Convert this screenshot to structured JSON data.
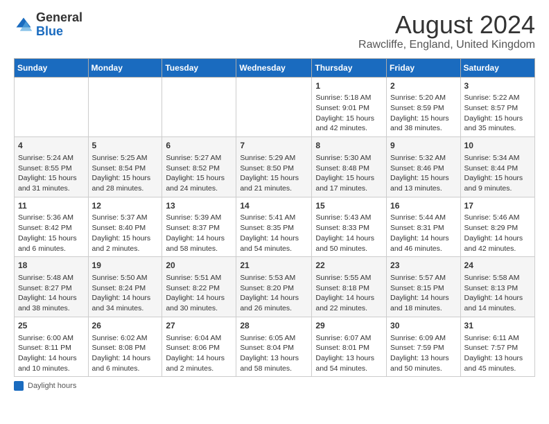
{
  "header": {
    "logo_line1": "General",
    "logo_line2": "Blue",
    "main_title": "August 2024",
    "sub_title": "Rawcliffe, England, United Kingdom"
  },
  "days_of_week": [
    "Sunday",
    "Monday",
    "Tuesday",
    "Wednesday",
    "Thursday",
    "Friday",
    "Saturday"
  ],
  "weeks": [
    [
      {
        "day": "",
        "info": ""
      },
      {
        "day": "",
        "info": ""
      },
      {
        "day": "",
        "info": ""
      },
      {
        "day": "",
        "info": ""
      },
      {
        "day": "1",
        "info": "Sunrise: 5:18 AM\nSunset: 9:01 PM\nDaylight: 15 hours and 42 minutes."
      },
      {
        "day": "2",
        "info": "Sunrise: 5:20 AM\nSunset: 8:59 PM\nDaylight: 15 hours and 38 minutes."
      },
      {
        "day": "3",
        "info": "Sunrise: 5:22 AM\nSunset: 8:57 PM\nDaylight: 15 hours and 35 minutes."
      }
    ],
    [
      {
        "day": "4",
        "info": "Sunrise: 5:24 AM\nSunset: 8:55 PM\nDaylight: 15 hours and 31 minutes."
      },
      {
        "day": "5",
        "info": "Sunrise: 5:25 AM\nSunset: 8:54 PM\nDaylight: 15 hours and 28 minutes."
      },
      {
        "day": "6",
        "info": "Sunrise: 5:27 AM\nSunset: 8:52 PM\nDaylight: 15 hours and 24 minutes."
      },
      {
        "day": "7",
        "info": "Sunrise: 5:29 AM\nSunset: 8:50 PM\nDaylight: 15 hours and 21 minutes."
      },
      {
        "day": "8",
        "info": "Sunrise: 5:30 AM\nSunset: 8:48 PM\nDaylight: 15 hours and 17 minutes."
      },
      {
        "day": "9",
        "info": "Sunrise: 5:32 AM\nSunset: 8:46 PM\nDaylight: 15 hours and 13 minutes."
      },
      {
        "day": "10",
        "info": "Sunrise: 5:34 AM\nSunset: 8:44 PM\nDaylight: 15 hours and 9 minutes."
      }
    ],
    [
      {
        "day": "11",
        "info": "Sunrise: 5:36 AM\nSunset: 8:42 PM\nDaylight: 15 hours and 6 minutes."
      },
      {
        "day": "12",
        "info": "Sunrise: 5:37 AM\nSunset: 8:40 PM\nDaylight: 15 hours and 2 minutes."
      },
      {
        "day": "13",
        "info": "Sunrise: 5:39 AM\nSunset: 8:37 PM\nDaylight: 14 hours and 58 minutes."
      },
      {
        "day": "14",
        "info": "Sunrise: 5:41 AM\nSunset: 8:35 PM\nDaylight: 14 hours and 54 minutes."
      },
      {
        "day": "15",
        "info": "Sunrise: 5:43 AM\nSunset: 8:33 PM\nDaylight: 14 hours and 50 minutes."
      },
      {
        "day": "16",
        "info": "Sunrise: 5:44 AM\nSunset: 8:31 PM\nDaylight: 14 hours and 46 minutes."
      },
      {
        "day": "17",
        "info": "Sunrise: 5:46 AM\nSunset: 8:29 PM\nDaylight: 14 hours and 42 minutes."
      }
    ],
    [
      {
        "day": "18",
        "info": "Sunrise: 5:48 AM\nSunset: 8:27 PM\nDaylight: 14 hours and 38 minutes."
      },
      {
        "day": "19",
        "info": "Sunrise: 5:50 AM\nSunset: 8:24 PM\nDaylight: 14 hours and 34 minutes."
      },
      {
        "day": "20",
        "info": "Sunrise: 5:51 AM\nSunset: 8:22 PM\nDaylight: 14 hours and 30 minutes."
      },
      {
        "day": "21",
        "info": "Sunrise: 5:53 AM\nSunset: 8:20 PM\nDaylight: 14 hours and 26 minutes."
      },
      {
        "day": "22",
        "info": "Sunrise: 5:55 AM\nSunset: 8:18 PM\nDaylight: 14 hours and 22 minutes."
      },
      {
        "day": "23",
        "info": "Sunrise: 5:57 AM\nSunset: 8:15 PM\nDaylight: 14 hours and 18 minutes."
      },
      {
        "day": "24",
        "info": "Sunrise: 5:58 AM\nSunset: 8:13 PM\nDaylight: 14 hours and 14 minutes."
      }
    ],
    [
      {
        "day": "25",
        "info": "Sunrise: 6:00 AM\nSunset: 8:11 PM\nDaylight: 14 hours and 10 minutes."
      },
      {
        "day": "26",
        "info": "Sunrise: 6:02 AM\nSunset: 8:08 PM\nDaylight: 14 hours and 6 minutes."
      },
      {
        "day": "27",
        "info": "Sunrise: 6:04 AM\nSunset: 8:06 PM\nDaylight: 14 hours and 2 minutes."
      },
      {
        "day": "28",
        "info": "Sunrise: 6:05 AM\nSunset: 8:04 PM\nDaylight: 13 hours and 58 minutes."
      },
      {
        "day": "29",
        "info": "Sunrise: 6:07 AM\nSunset: 8:01 PM\nDaylight: 13 hours and 54 minutes."
      },
      {
        "day": "30",
        "info": "Sunrise: 6:09 AM\nSunset: 7:59 PM\nDaylight: 13 hours and 50 minutes."
      },
      {
        "day": "31",
        "info": "Sunrise: 6:11 AM\nSunset: 7:57 PM\nDaylight: 13 hours and 45 minutes."
      }
    ]
  ],
  "footer": {
    "note": "Daylight hours"
  }
}
